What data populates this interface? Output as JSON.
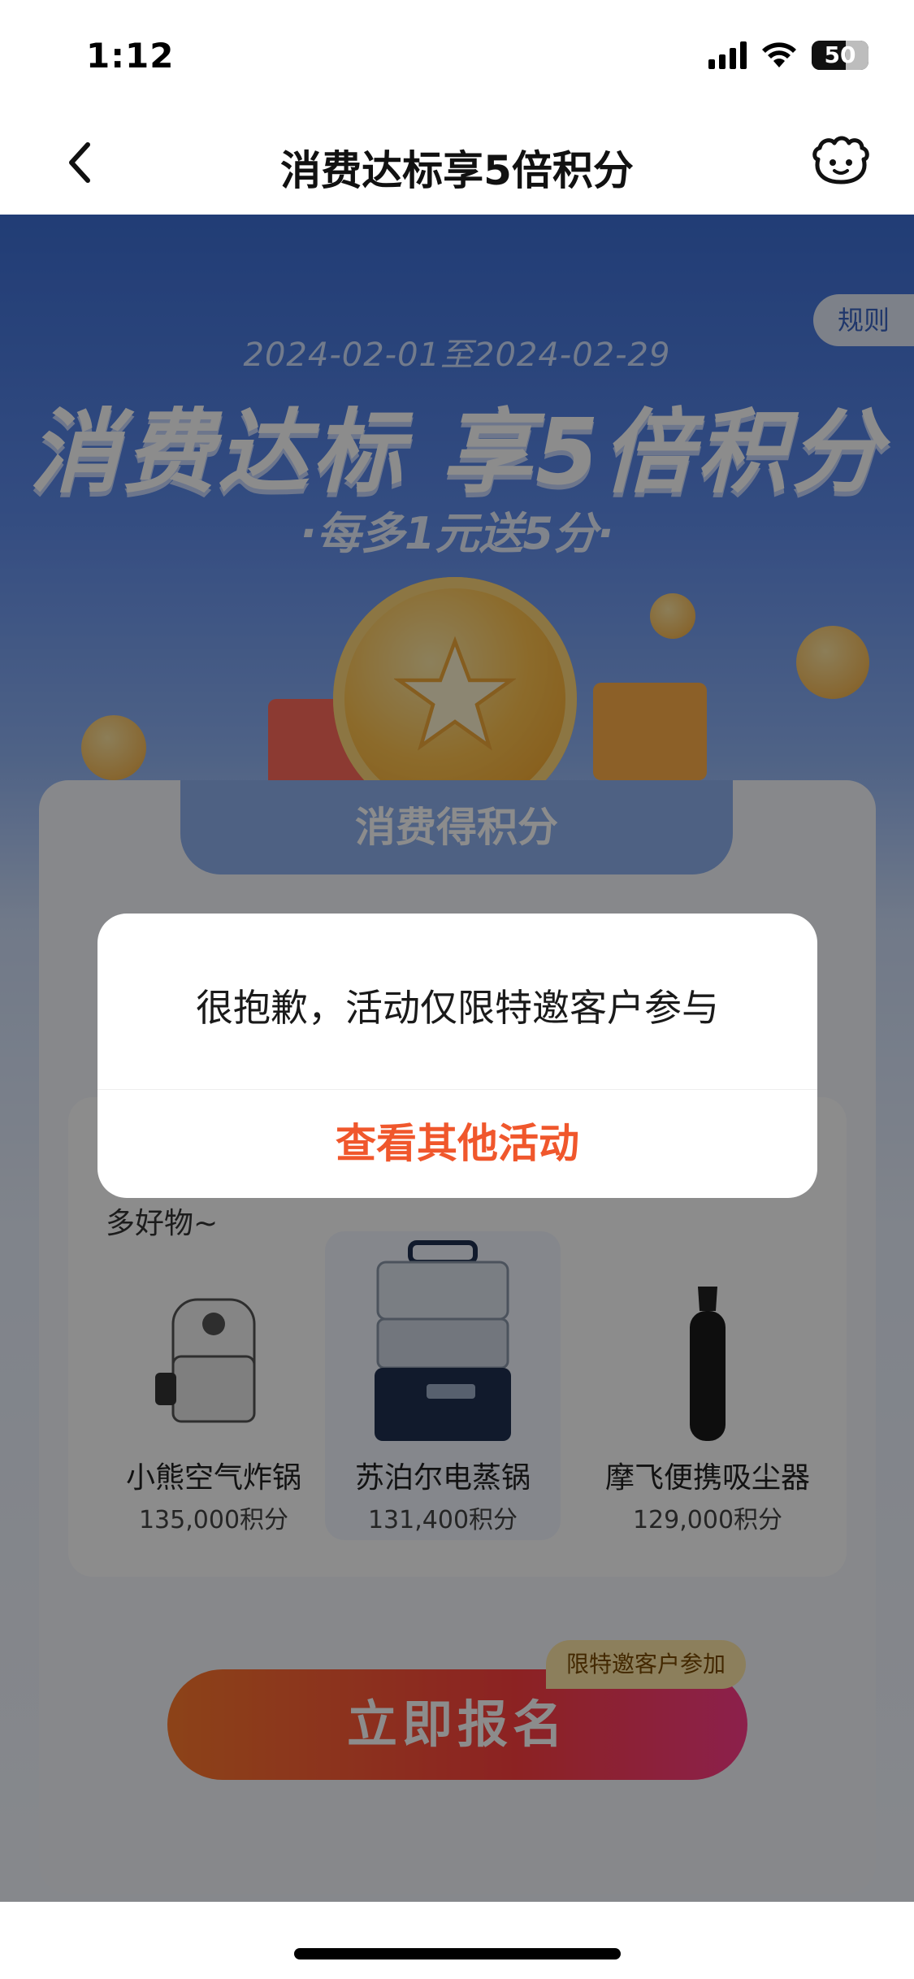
{
  "status_bar": {
    "time": "1:12",
    "battery": "50"
  },
  "nav": {
    "title": "消费达标享5倍积分"
  },
  "banner": {
    "rules_label": "规则",
    "date_range": "2024-02-01至2024-02-29",
    "title": "消费达标 享5倍积分",
    "subtitle": "·每多1元送5分·"
  },
  "card": {
    "tab_title": "消费得积分",
    "more_text": "多好物~",
    "products": [
      {
        "name": "小熊空气炸锅",
        "points": "135,000积分"
      },
      {
        "name": "苏泊尔电蒸锅",
        "points": "131,400积分"
      },
      {
        "name": "摩飞便携吸尘器",
        "points": "129,000积分"
      }
    ]
  },
  "cta": {
    "badge": "限特邀客户参加",
    "label": "立即报名"
  },
  "dialog": {
    "message": "很抱歉，活动仅限特邀客户参与",
    "action": "查看其他活动"
  },
  "colors": {
    "accent": "#f0572c",
    "primary_blue": "#3d6fd6"
  }
}
